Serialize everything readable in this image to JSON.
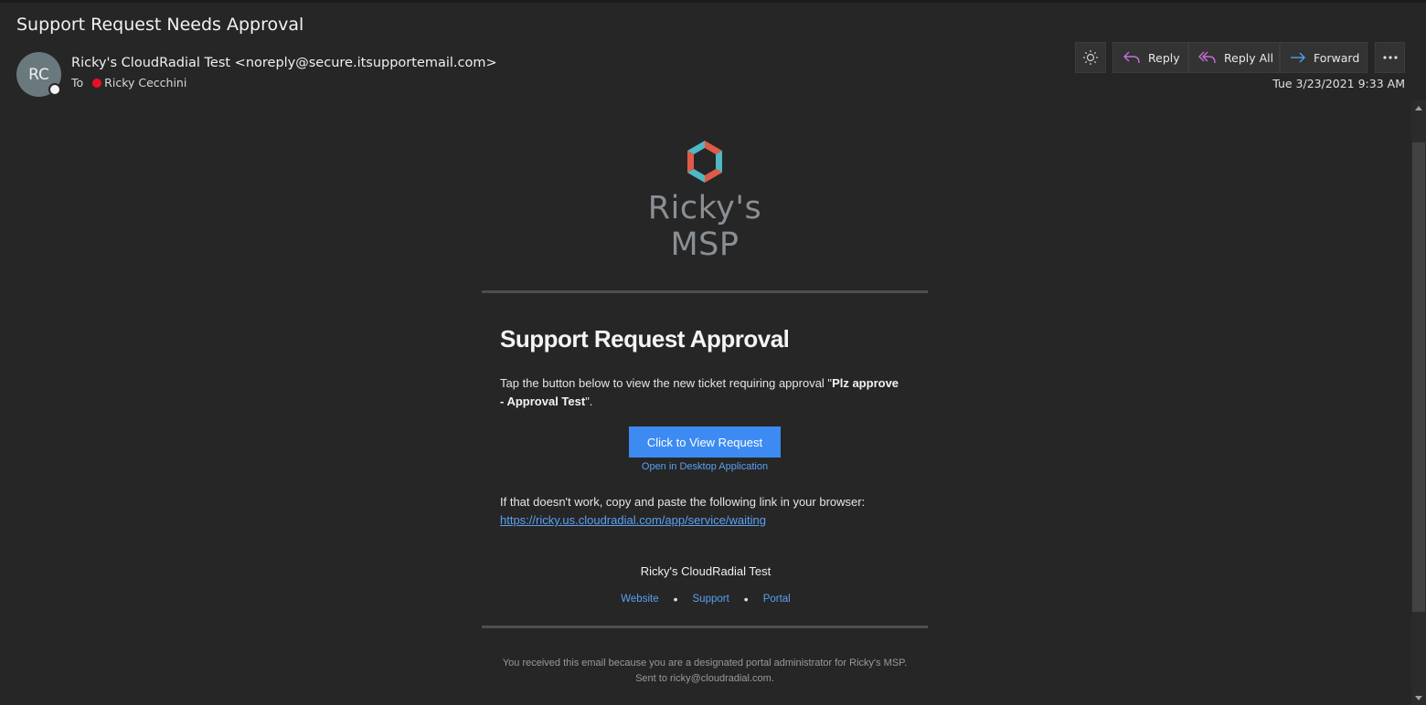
{
  "email": {
    "subject": "Support Request Needs Approval",
    "avatar_initials": "RC",
    "sender": "Ricky's CloudRadial Test <noreply@secure.itsupportemail.com>",
    "to_label": "To",
    "recipient": "Ricky Cecchini",
    "date": "Tue 3/23/2021 9:33 AM"
  },
  "toolbar": {
    "theme_icon": "sun-icon",
    "reply_label": "Reply",
    "reply_all_label": "Reply All",
    "forward_label": "Forward",
    "more_icon": "more-icon"
  },
  "body": {
    "logo_text": "Ricky's MSP",
    "title": "Support Request Approval",
    "intro_prefix": "Tap the button below to view the new ticket requiring approval \"",
    "ticket_name": "Plz approve - Approval Test",
    "intro_suffix": "\".",
    "cta_label": "Click to View Request",
    "desktop_link": "Open in Desktop Application",
    "fallback_text": "If that doesn't work, copy and paste the following link in your browser:",
    "fallback_url": "https://ricky.us.cloudradial.com/app/service/waiting",
    "org_name": "Ricky's CloudRadial Test",
    "footer_links": [
      "Website",
      "Support",
      "Portal"
    ],
    "separator": "•",
    "disclaimer_line1": "You received this email because you are a designated portal administrator for Ricky's MSP.",
    "disclaimer_line2": "Sent to ricky@cloudradial.com."
  },
  "colors": {
    "background": "#262626",
    "accent_blue": "#3d8bf2",
    "link_blue": "#5aa0f2",
    "presence_busy": "#e81123",
    "logo_red": "#e05a47",
    "logo_teal": "#4fb8c4"
  }
}
